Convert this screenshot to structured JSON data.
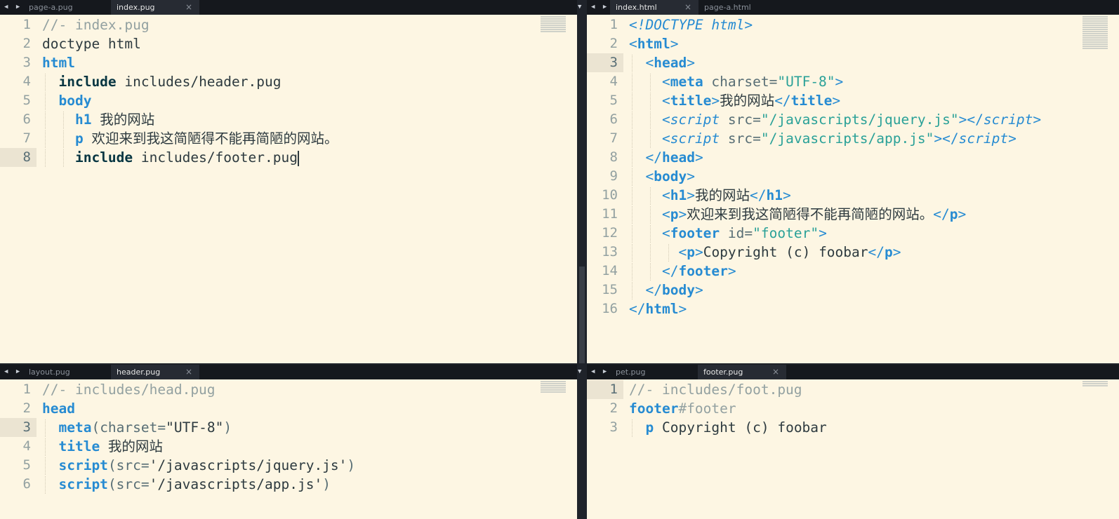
{
  "panes": {
    "top_left": {
      "tabs": [
        {
          "label": "page-a.pug"
        },
        {
          "label": "index.pug",
          "close": "×"
        }
      ],
      "lines": [
        {
          "num": "1",
          "t": [
            {
              "c": "c",
              "v": "//- index.pug"
            }
          ]
        },
        {
          "num": "2",
          "t": [
            {
              "c": "pl",
              "v": "doctype html"
            }
          ]
        },
        {
          "num": "3",
          "t": [
            {
              "c": "kw",
              "v": "html"
            }
          ]
        },
        {
          "num": "4",
          "t": [
            {
              "c": "pl",
              "v": "  "
            },
            {
              "c": "kwd",
              "v": "include"
            },
            {
              "c": "pl",
              "v": " includes/header.pug"
            }
          ]
        },
        {
          "num": "5",
          "t": [
            {
              "c": "pl",
              "v": "  "
            },
            {
              "c": "kw",
              "v": "body"
            }
          ]
        },
        {
          "num": "6",
          "t": [
            {
              "c": "pl",
              "v": "    "
            },
            {
              "c": "kw",
              "v": "h1"
            },
            {
              "c": "pl",
              "v": " 我的网站"
            }
          ]
        },
        {
          "num": "7",
          "t": [
            {
              "c": "pl",
              "v": "    "
            },
            {
              "c": "kw",
              "v": "p"
            },
            {
              "c": "pl",
              "v": " 欢迎来到我这简陋得不能再简陋的网站。"
            }
          ]
        },
        {
          "num": "8",
          "t": [
            {
              "c": "pl",
              "v": "    "
            },
            {
              "c": "kwd",
              "v": "include"
            },
            {
              "c": "pl",
              "v": " includes/footer.pug"
            }
          ]
        }
      ]
    },
    "top_right": {
      "tabs": [
        {
          "label": "index.html",
          "close": "×"
        },
        {
          "label": "page-a.html"
        }
      ],
      "lines": [
        {
          "num": "1",
          "t": [
            {
              "c": "it",
              "v": "<!DOCTYPE html>"
            }
          ]
        },
        {
          "num": "2",
          "t": [
            {
              "c": "ang",
              "v": "<"
            },
            {
              "c": "tg",
              "v": "html"
            },
            {
              "c": "ang",
              "v": ">"
            }
          ]
        },
        {
          "num": "3",
          "t": [
            {
              "c": "pl",
              "v": "  "
            },
            {
              "c": "ang",
              "v": "<"
            },
            {
              "c": "tg",
              "v": "head"
            },
            {
              "c": "ang",
              "v": ">"
            }
          ]
        },
        {
          "num": "4",
          "t": [
            {
              "c": "pl",
              "v": "    "
            },
            {
              "c": "ang",
              "v": "<"
            },
            {
              "c": "tg",
              "v": "meta"
            },
            {
              "c": "at",
              "v": " charset="
            },
            {
              "c": "st",
              "v": "\"UTF-8\""
            },
            {
              "c": "ang",
              "v": ">"
            }
          ]
        },
        {
          "num": "5",
          "t": [
            {
              "c": "pl",
              "v": "    "
            },
            {
              "c": "ang",
              "v": "<"
            },
            {
              "c": "tg",
              "v": "title"
            },
            {
              "c": "ang",
              "v": ">"
            },
            {
              "c": "pl",
              "v": "我的网站"
            },
            {
              "c": "ang",
              "v": "</"
            },
            {
              "c": "tg",
              "v": "title"
            },
            {
              "c": "ang",
              "v": ">"
            }
          ]
        },
        {
          "num": "6",
          "t": [
            {
              "c": "pl",
              "v": "    "
            },
            {
              "c": "ang",
              "v": "<"
            },
            {
              "c": "it",
              "v": "script"
            },
            {
              "c": "at",
              "v": " src="
            },
            {
              "c": "st",
              "v": "\"/javascripts/jquery.js\""
            },
            {
              "c": "ang",
              "v": "></"
            },
            {
              "c": "it",
              "v": "script"
            },
            {
              "c": "ang",
              "v": ">"
            }
          ]
        },
        {
          "num": "7",
          "t": [
            {
              "c": "pl",
              "v": "    "
            },
            {
              "c": "ang",
              "v": "<"
            },
            {
              "c": "it",
              "v": "script"
            },
            {
              "c": "at",
              "v": " src="
            },
            {
              "c": "st",
              "v": "\"/javascripts/app.js\""
            },
            {
              "c": "ang",
              "v": "></"
            },
            {
              "c": "it",
              "v": "script"
            },
            {
              "c": "ang",
              "v": ">"
            }
          ]
        },
        {
          "num": "8",
          "t": [
            {
              "c": "pl",
              "v": "  "
            },
            {
              "c": "ang",
              "v": "</"
            },
            {
              "c": "tg",
              "v": "head"
            },
            {
              "c": "ang",
              "v": ">"
            }
          ]
        },
        {
          "num": "9",
          "t": [
            {
              "c": "pl",
              "v": "  "
            },
            {
              "c": "ang",
              "v": "<"
            },
            {
              "c": "tg",
              "v": "body"
            },
            {
              "c": "ang",
              "v": ">"
            }
          ]
        },
        {
          "num": "10",
          "t": [
            {
              "c": "pl",
              "v": "    "
            },
            {
              "c": "ang",
              "v": "<"
            },
            {
              "c": "tg",
              "v": "h1"
            },
            {
              "c": "ang",
              "v": ">"
            },
            {
              "c": "pl",
              "v": "我的网站"
            },
            {
              "c": "ang",
              "v": "</"
            },
            {
              "c": "tg",
              "v": "h1"
            },
            {
              "c": "ang",
              "v": ">"
            }
          ]
        },
        {
          "num": "11",
          "t": [
            {
              "c": "pl",
              "v": "    "
            },
            {
              "c": "ang",
              "v": "<"
            },
            {
              "c": "tg",
              "v": "p"
            },
            {
              "c": "ang",
              "v": ">"
            },
            {
              "c": "pl",
              "v": "欢迎来到我这简陋得不能再简陋的网站。"
            },
            {
              "c": "ang",
              "v": "</"
            },
            {
              "c": "tg",
              "v": "p"
            },
            {
              "c": "ang",
              "v": ">"
            }
          ]
        },
        {
          "num": "12",
          "t": [
            {
              "c": "pl",
              "v": "    "
            },
            {
              "c": "ang",
              "v": "<"
            },
            {
              "c": "tg",
              "v": "footer"
            },
            {
              "c": "at",
              "v": " id="
            },
            {
              "c": "st",
              "v": "\"footer\""
            },
            {
              "c": "ang",
              "v": ">"
            }
          ]
        },
        {
          "num": "13",
          "t": [
            {
              "c": "pl",
              "v": "      "
            },
            {
              "c": "ang",
              "v": "<"
            },
            {
              "c": "tg",
              "v": "p"
            },
            {
              "c": "ang",
              "v": ">"
            },
            {
              "c": "pl",
              "v": "Copyright (c) foobar"
            },
            {
              "c": "ang",
              "v": "</"
            },
            {
              "c": "tg",
              "v": "p"
            },
            {
              "c": "ang",
              "v": ">"
            }
          ]
        },
        {
          "num": "14",
          "t": [
            {
              "c": "pl",
              "v": "    "
            },
            {
              "c": "ang",
              "v": "</"
            },
            {
              "c": "tg",
              "v": "footer"
            },
            {
              "c": "ang",
              "v": ">"
            }
          ]
        },
        {
          "num": "15",
          "t": [
            {
              "c": "pl",
              "v": "  "
            },
            {
              "c": "ang",
              "v": "</"
            },
            {
              "c": "tg",
              "v": "body"
            },
            {
              "c": "ang",
              "v": ">"
            }
          ]
        },
        {
          "num": "16",
          "t": [
            {
              "c": "ang",
              "v": "</"
            },
            {
              "c": "tg",
              "v": "html"
            },
            {
              "c": "ang",
              "v": ">"
            }
          ]
        }
      ]
    },
    "bottom_left": {
      "tabs": [
        {
          "label": "layout.pug"
        },
        {
          "label": "header.pug",
          "close": "×"
        }
      ],
      "lines": [
        {
          "num": "1",
          "t": [
            {
              "c": "c",
              "v": "//- includes/head.pug"
            }
          ]
        },
        {
          "num": "2",
          "t": [
            {
              "c": "kw",
              "v": "head"
            }
          ]
        },
        {
          "num": "3",
          "t": [
            {
              "c": "pl",
              "v": "  "
            },
            {
              "c": "kw",
              "v": "meta"
            },
            {
              "c": "pn",
              "v": "(charset="
            },
            {
              "c": "pl",
              "v": "\"UTF-8\""
            },
            {
              "c": "pn",
              "v": ")"
            }
          ]
        },
        {
          "num": "4",
          "t": [
            {
              "c": "pl",
              "v": "  "
            },
            {
              "c": "kw",
              "v": "title"
            },
            {
              "c": "pl",
              "v": " 我的网站"
            }
          ]
        },
        {
          "num": "5",
          "t": [
            {
              "c": "pl",
              "v": "  "
            },
            {
              "c": "kw",
              "v": "script"
            },
            {
              "c": "pn",
              "v": "(src="
            },
            {
              "c": "pl",
              "v": "'/javascripts/jquery.js'"
            },
            {
              "c": "pn",
              "v": ")"
            }
          ]
        },
        {
          "num": "6",
          "t": [
            {
              "c": "pl",
              "v": "  "
            },
            {
              "c": "kw",
              "v": "script"
            },
            {
              "c": "pn",
              "v": "(src="
            },
            {
              "c": "pl",
              "v": "'/javascripts/app.js'"
            },
            {
              "c": "pn",
              "v": ")"
            }
          ]
        }
      ]
    },
    "bottom_right": {
      "tabs": [
        {
          "label": "pet.pug"
        },
        {
          "label": "footer.pug",
          "close": "×"
        }
      ],
      "lines": [
        {
          "num": "1",
          "t": [
            {
              "c": "c",
              "v": "//- includes/foot.pug"
            }
          ]
        },
        {
          "num": "2",
          "t": [
            {
              "c": "kw",
              "v": "footer"
            },
            {
              "c": "c",
              "v": "#footer"
            }
          ]
        },
        {
          "num": "3",
          "t": [
            {
              "c": "pl",
              "v": "  "
            },
            {
              "c": "kw",
              "v": "p"
            },
            {
              "c": "pl",
              "v": " Copyright (c) foobar"
            }
          ]
        }
      ]
    }
  },
  "icons": {
    "tab_nav": "◀ ▶",
    "dropdown": "▼"
  },
  "colors": {
    "editor_bg": "#fdf6e3",
    "keyword": "#268bd2",
    "string": "#2aa198",
    "comment": "#93a1a1",
    "tabbar": "#15181d"
  }
}
